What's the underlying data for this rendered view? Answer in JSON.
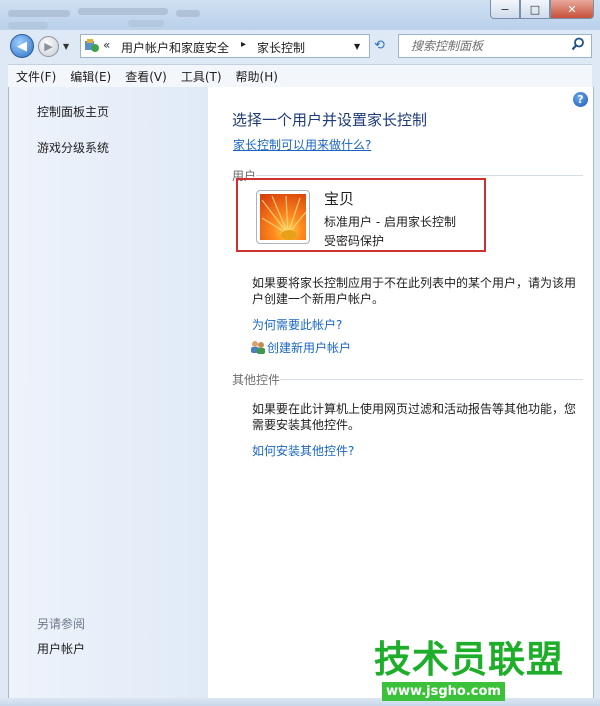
{
  "window": {
    "min_label": "−",
    "max_label": "□",
    "close_label": "✕"
  },
  "nav": {
    "back_glyph": "◀",
    "fwd_glyph": "▶",
    "addr_chevron": "«",
    "breadcrumb": [
      "用户帐户和家庭安全",
      "家长控制"
    ],
    "crumb_sep": "▸",
    "search_placeholder": "搜索控制面板"
  },
  "menu": [
    "文件(F)",
    "编辑(E)",
    "查看(V)",
    "工具(T)",
    "帮助(H)"
  ],
  "sidebar": {
    "links": [
      "控制面板主页",
      "游戏分级系统"
    ],
    "see_also_label": "另请参阅",
    "see_also_links": [
      "用户帐户"
    ]
  },
  "main": {
    "help_glyph": "?",
    "heading": "选择一个用户并设置家长控制",
    "what_link": "家长控制可以用来做什么?",
    "users_section": "用户",
    "user": {
      "name": "宝贝",
      "line1": "标准用户 - 启用家长控制",
      "line2": "受密码保护"
    },
    "add_user_text": "如果要将家长控制应用于不在此列表中的某个用户，请为该用户创建一个新用户帐户。",
    "why_link": "为何需要此帐户?",
    "create_link": "创建新用户帐户",
    "other_section": "其他控件",
    "other_text": "如果要在此计算机上使用网页过滤和活动报告等其他功能，您需要安装其他控件。",
    "install_link": "如何安装其他控件?"
  },
  "watermark": {
    "text": "技术员联盟",
    "url": "www.jsgho.com"
  },
  "colors": {
    "link": "#1a66c2",
    "heading": "#1e3a78",
    "highlight_border": "#d0312d",
    "watermark": "#1fae2a"
  }
}
